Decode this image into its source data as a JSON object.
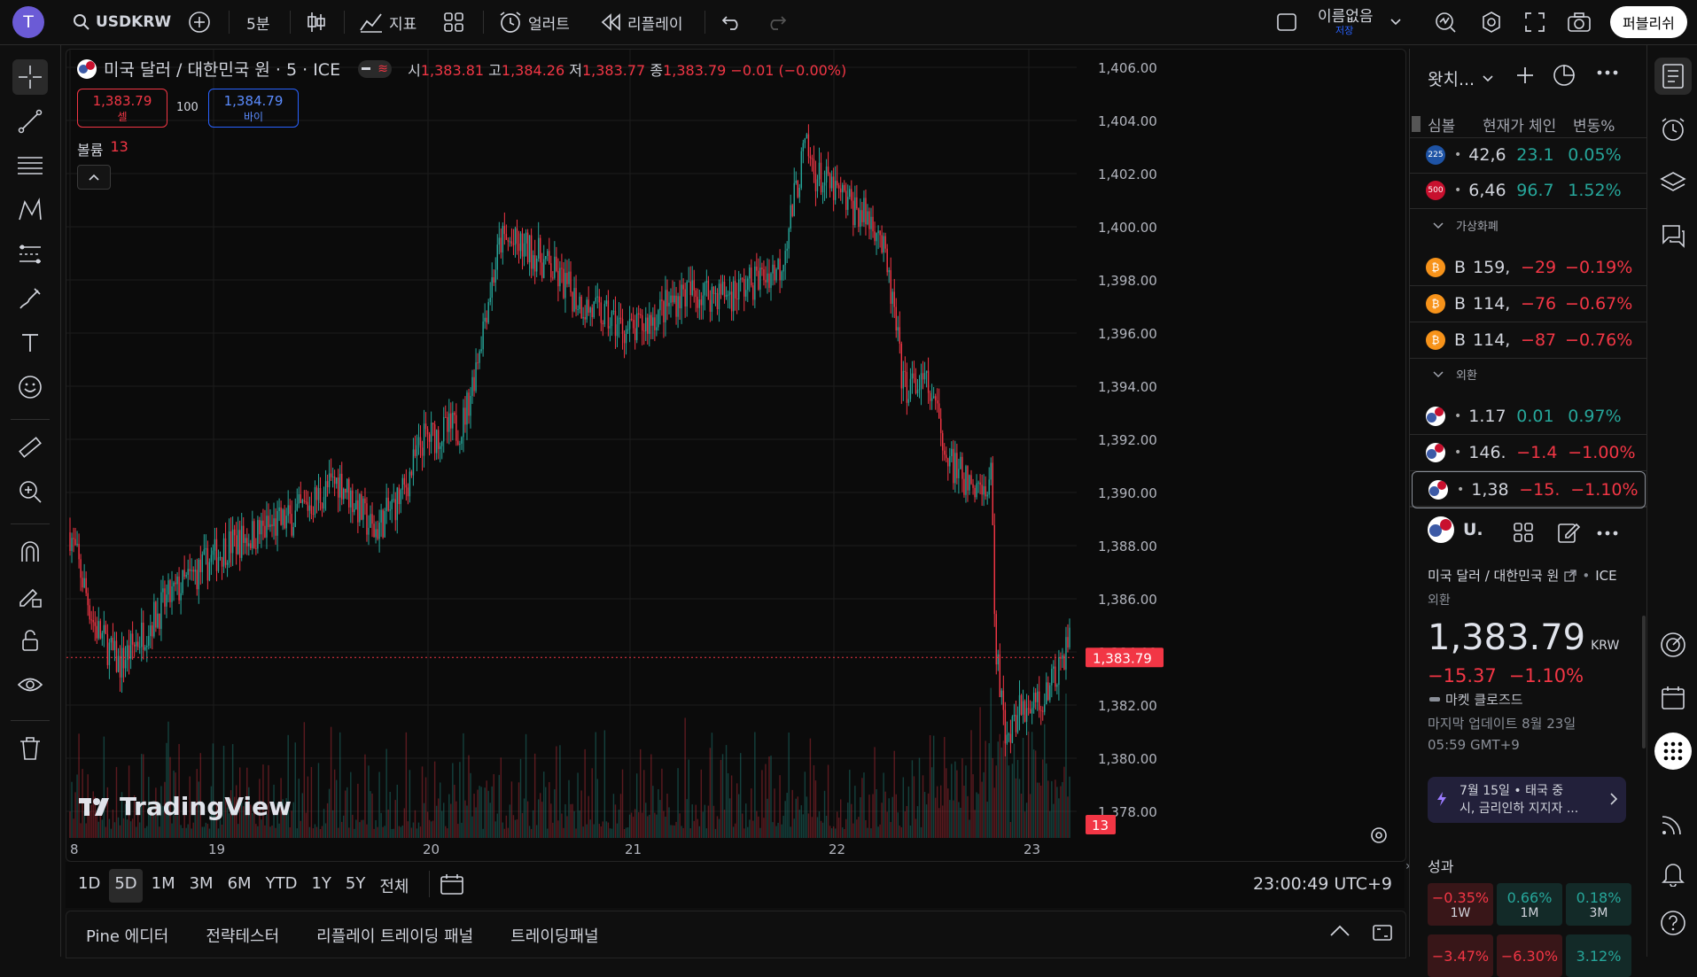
{
  "topbar": {
    "avatar": "T",
    "symbol": "USDKRW",
    "interval": "5분",
    "indicators": "지표",
    "alert": "얼러트",
    "replay": "리플레이",
    "layout_name": "이름없음",
    "layout_saved": "저장",
    "publish": "퍼블리쉬"
  },
  "legend": {
    "title": "미국 달러 / 대한민국 원 · 5 · ICE",
    "o_label": "시",
    "o": "1,383.81",
    "h_label": "고",
    "h": "1,384.26",
    "l_label": "저",
    "l": "1,383.77",
    "c_label": "종",
    "c": "1,383.79",
    "chg": "−0.01 (−0.00%)",
    "sell_price": "1,383.79",
    "sell_label": "셀",
    "spread": "100",
    "buy_price": "1,384.79",
    "buy_label": "바이",
    "volume_label": "볼륨",
    "volume": "13"
  },
  "chart_data": {
    "type": "candlestick",
    "symbol": "USDKRW",
    "y_ticks": [
      "1,406.00",
      "1,404.00",
      "1,402.00",
      "1,400.00",
      "1,398.00",
      "1,396.00",
      "1,394.00",
      "1,392.00",
      "1,390.00",
      "1,388.00",
      "1,386.00",
      "1,384.00",
      "1,382.00",
      "1,380.00",
      "1,378.00"
    ],
    "ylim": [
      1377,
      1406.5
    ],
    "x_ticks": [
      "8",
      "19",
      "20",
      "21",
      "22",
      "23"
    ],
    "last_price": "1,383.79",
    "last_volume": "13",
    "price_path": [
      {
        "x": 0,
        "y": 1388.5
      },
      {
        "x": 5,
        "y": 1385.0
      },
      {
        "x": 10,
        "y": 1383.5
      },
      {
        "x": 20,
        "y": 1386.0
      },
      {
        "x": 32,
        "y": 1388.0
      },
      {
        "x": 45,
        "y": 1389.0
      },
      {
        "x": 55,
        "y": 1390.5
      },
      {
        "x": 62,
        "y": 1388.5
      },
      {
        "x": 68,
        "y": 1390.0
      },
      {
        "x": 72,
        "y": 1392.0
      },
      {
        "x": 80,
        "y": 1392.5
      },
      {
        "x": 82,
        "y": 1394.0
      },
      {
        "x": 85,
        "y": 1397.0
      },
      {
        "x": 88,
        "y": 1399.5
      },
      {
        "x": 95,
        "y": 1399.0
      },
      {
        "x": 105,
        "y": 1397.0
      },
      {
        "x": 115,
        "y": 1396.0
      },
      {
        "x": 125,
        "y": 1397.5
      },
      {
        "x": 135,
        "y": 1397.5
      },
      {
        "x": 145,
        "y": 1398.5
      },
      {
        "x": 150,
        "y": 1403.0
      },
      {
        "x": 152,
        "y": 1402.0
      },
      {
        "x": 158,
        "y": 1401.0
      },
      {
        "x": 165,
        "y": 1400.0
      },
      {
        "x": 168,
        "y": 1397.0
      },
      {
        "x": 170,
        "y": 1394.0
      },
      {
        "x": 175,
        "y": 1394.0
      },
      {
        "x": 180,
        "y": 1391.0
      },
      {
        "x": 185,
        "y": 1390.0
      },
      {
        "x": 188,
        "y": 1390.5
      },
      {
        "x": 189,
        "y": 1384.0
      },
      {
        "x": 191,
        "y": 1381.0
      },
      {
        "x": 195,
        "y": 1382.0
      },
      {
        "x": 200,
        "y": 1382.5
      },
      {
        "x": 204,
        "y": 1384.5
      }
    ]
  },
  "chart": {
    "watermark": "TradingView",
    "time_display": "23:00:49 UTC+9"
  },
  "ranges": [
    "1D",
    "5D",
    "1M",
    "3M",
    "6M",
    "YTD",
    "1Y",
    "5Y",
    "전체"
  ],
  "bottom_tabs": [
    "Pine 에디터",
    "전략테스터",
    "리플레이 트레이딩 패널",
    "트레이딩패널"
  ],
  "watchlist": {
    "title": "왓치...",
    "columns": [
      "심볼",
      "현재가",
      "체인지",
      "변동%"
    ],
    "rows": [
      {
        "icon": "225",
        "icon_color": "#1e53a5",
        "sym": "•",
        "last": "42,6",
        "chg": "23.1",
        "pct": "0.05%",
        "dir": "up"
      },
      {
        "icon": "500",
        "icon_color": "#c8102e",
        "sym": "•",
        "last": "6,46",
        "chg": "96.7",
        "pct": "1.52%",
        "dir": "up"
      }
    ],
    "section_crypto": "가상화폐",
    "crypto": [
      {
        "sym": "B",
        "last": "159,",
        "chg": "−29",
        "pct": "−0.19%",
        "dir": "down"
      },
      {
        "sym": "B",
        "last": "114,",
        "chg": "−76",
        "pct": "−0.67%",
        "dir": "down"
      },
      {
        "sym": "B",
        "last": "114,",
        "chg": "−87",
        "pct": "−0.76%",
        "dir": "down"
      }
    ],
    "section_fx": "외환",
    "fx": [
      {
        "sym": "•",
        "last": "1.17",
        "chg": "0.01",
        "pct": "0.97%",
        "dir": "up"
      },
      {
        "sym": "•",
        "last": "146.",
        "chg": "−1.4",
        "pct": "−1.00%",
        "dir": "down"
      },
      {
        "sym": "•",
        "last": "1,38",
        "chg": "−15.",
        "pct": "−1.10%",
        "dir": "down"
      }
    ]
  },
  "details": {
    "short_sym": "U.",
    "name": "미국 달러 / 대한민국 원",
    "exchange": "ICE",
    "category": "외환",
    "price": "1,383.79",
    "currency": "KRW",
    "change": "−15.37",
    "change_pct": "−1.10%",
    "market_status": "마켓 클로즈드",
    "last_update_1": "마지막 업데이트 8월 23일",
    "last_update_2": "05:59 GMT+9",
    "news_1": "7월 15일 • 태국 중",
    "news_2": "시, 금리인하 지지자 ...",
    "perf_title": "성과",
    "perf": [
      {
        "value": "−0.35%",
        "label": "1W",
        "dir": "down"
      },
      {
        "value": "0.66%",
        "label": "1M",
        "dir": "up"
      },
      {
        "value": "0.18%",
        "label": "3M",
        "dir": "up"
      },
      {
        "value": "−3.47%",
        "label": "",
        "dir": "down"
      },
      {
        "value": "−6.30%",
        "label": "",
        "dir": "down"
      },
      {
        "value": "3.12%",
        "label": "",
        "dir": "up"
      }
    ]
  },
  "colors": {
    "up": "#26a69a",
    "down": "#f23645",
    "accent": "#2962ff"
  }
}
